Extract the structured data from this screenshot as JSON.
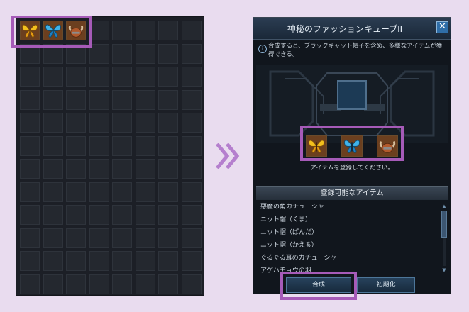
{
  "inventory": {
    "columns": 8,
    "rows": 12,
    "items": [
      {
        "icon": "yellow-butterfly-icon"
      },
      {
        "icon": "blue-butterfly-icon"
      },
      {
        "icon": "horned-helmet-icon"
      }
    ]
  },
  "arrow": {
    "icon": "double-chevron-right-icon",
    "color": "#b57fce"
  },
  "cube": {
    "title": "神秘のファッションキューブII",
    "close_label": "✕",
    "info_icon": "i",
    "description": "合成すると、ブラックキャット帽子を含め、多様なアイテムが獲得できる。",
    "ingredients": [
      {
        "icon": "yellow-butterfly-icon"
      },
      {
        "icon": "blue-butterfly-icon"
      },
      {
        "icon": "horned-helmet-icon"
      }
    ],
    "register_hint": "アイテムを登録してください。",
    "list_title": "登録可能なアイテム",
    "list_items": [
      "悪魔の角カチューシャ",
      "ニット帽（くま）",
      "ニット帽（ぱんだ）",
      "ニット帽（かえる）",
      "ぐるぐる耳のカチューシャ",
      "アゲハチョウの羽"
    ],
    "buttons": {
      "combine": "合成",
      "reset": "初期化"
    }
  },
  "colors": {
    "highlight": "#a65bb8",
    "background": "#e9dcef",
    "window_bg": "#11161d",
    "title_bar": "#1a2838"
  }
}
